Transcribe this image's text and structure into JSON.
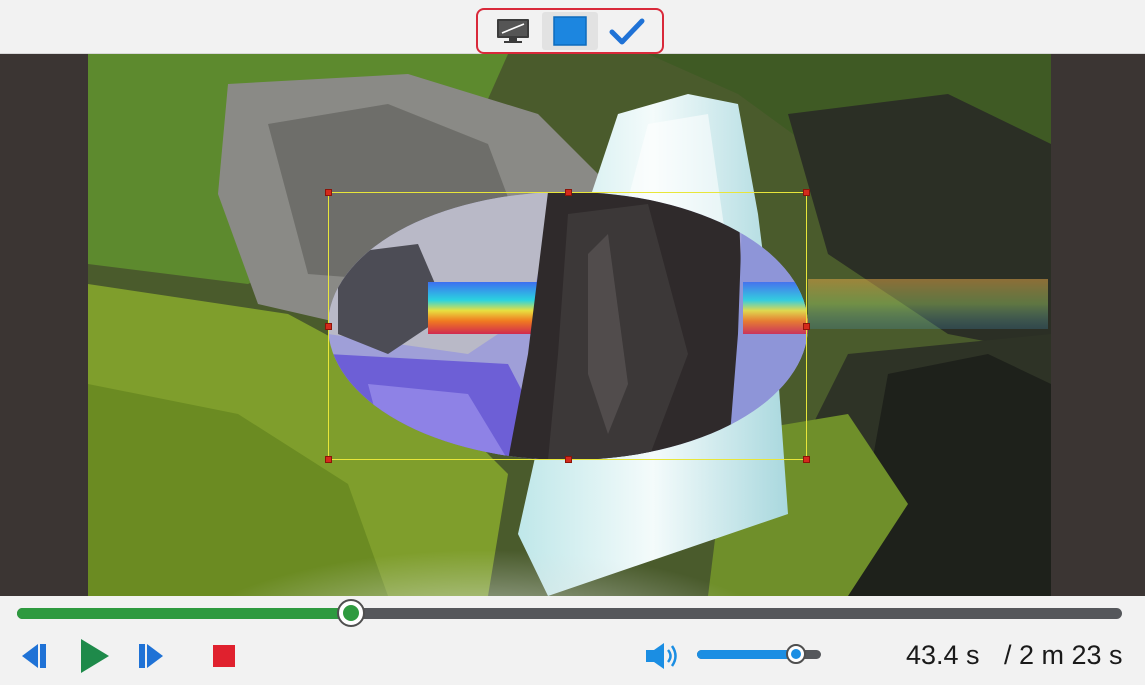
{
  "toolbar": {
    "tools": [
      {
        "icon": "monitor-icon",
        "active": false
      },
      {
        "icon": "blue-square-icon",
        "active": true
      },
      {
        "icon": "checkmark-icon",
        "active": false
      }
    ],
    "highlight_color": "#d9293a"
  },
  "player": {
    "progress_fraction": 0.302,
    "volume_fraction": 0.8,
    "current_time": "43.4 s",
    "total_time": "/ 2 m 23 s",
    "accent_progress": "#2e9a3f",
    "accent_volume": "#1b8ee3"
  },
  "controls": {
    "icons": [
      "previous-frame-icon",
      "play-icon",
      "next-frame-icon",
      "stop-icon",
      "volume-icon"
    ]
  },
  "video": {
    "selection_shape": "ellipse",
    "selection_color": "#e8e63a"
  }
}
